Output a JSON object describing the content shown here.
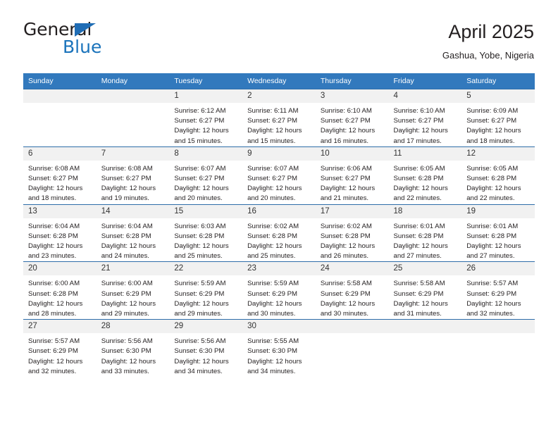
{
  "brand": {
    "name_top": "General",
    "name_bottom": "Blue",
    "accent_color": "#1a73bb",
    "triangle_color": "#1f6db5"
  },
  "header": {
    "title": "April 2025",
    "subtitle": "Gashua, Yobe, Nigeria"
  },
  "theme": {
    "header_bg": "#3279bd",
    "row_separator": "#2e6da9",
    "daynum_bg": "#f1f1f1",
    "text": "#231f20"
  },
  "calendar": {
    "weekday_headers": [
      "Sunday",
      "Monday",
      "Tuesday",
      "Wednesday",
      "Thursday",
      "Friday",
      "Saturday"
    ],
    "weeks": [
      [
        {
          "day": "",
          "blank": true
        },
        {
          "day": "",
          "blank": true
        },
        {
          "day": "1",
          "sunrise": "Sunrise: 6:12 AM",
          "sunset": "Sunset: 6:27 PM",
          "daylight_1": "Daylight: 12 hours",
          "daylight_2": "and 15 minutes."
        },
        {
          "day": "2",
          "sunrise": "Sunrise: 6:11 AM",
          "sunset": "Sunset: 6:27 PM",
          "daylight_1": "Daylight: 12 hours",
          "daylight_2": "and 15 minutes."
        },
        {
          "day": "3",
          "sunrise": "Sunrise: 6:10 AM",
          "sunset": "Sunset: 6:27 PM",
          "daylight_1": "Daylight: 12 hours",
          "daylight_2": "and 16 minutes."
        },
        {
          "day": "4",
          "sunrise": "Sunrise: 6:10 AM",
          "sunset": "Sunset: 6:27 PM",
          "daylight_1": "Daylight: 12 hours",
          "daylight_2": "and 17 minutes."
        },
        {
          "day": "5",
          "sunrise": "Sunrise: 6:09 AM",
          "sunset": "Sunset: 6:27 PM",
          "daylight_1": "Daylight: 12 hours",
          "daylight_2": "and 18 minutes."
        }
      ],
      [
        {
          "day": "6",
          "sunrise": "Sunrise: 6:08 AM",
          "sunset": "Sunset: 6:27 PM",
          "daylight_1": "Daylight: 12 hours",
          "daylight_2": "and 18 minutes."
        },
        {
          "day": "7",
          "sunrise": "Sunrise: 6:08 AM",
          "sunset": "Sunset: 6:27 PM",
          "daylight_1": "Daylight: 12 hours",
          "daylight_2": "and 19 minutes."
        },
        {
          "day": "8",
          "sunrise": "Sunrise: 6:07 AM",
          "sunset": "Sunset: 6:27 PM",
          "daylight_1": "Daylight: 12 hours",
          "daylight_2": "and 20 minutes."
        },
        {
          "day": "9",
          "sunrise": "Sunrise: 6:07 AM",
          "sunset": "Sunset: 6:27 PM",
          "daylight_1": "Daylight: 12 hours",
          "daylight_2": "and 20 minutes."
        },
        {
          "day": "10",
          "sunrise": "Sunrise: 6:06 AM",
          "sunset": "Sunset: 6:27 PM",
          "daylight_1": "Daylight: 12 hours",
          "daylight_2": "and 21 minutes."
        },
        {
          "day": "11",
          "sunrise": "Sunrise: 6:05 AM",
          "sunset": "Sunset: 6:28 PM",
          "daylight_1": "Daylight: 12 hours",
          "daylight_2": "and 22 minutes."
        },
        {
          "day": "12",
          "sunrise": "Sunrise: 6:05 AM",
          "sunset": "Sunset: 6:28 PM",
          "daylight_1": "Daylight: 12 hours",
          "daylight_2": "and 22 minutes."
        }
      ],
      [
        {
          "day": "13",
          "sunrise": "Sunrise: 6:04 AM",
          "sunset": "Sunset: 6:28 PM",
          "daylight_1": "Daylight: 12 hours",
          "daylight_2": "and 23 minutes."
        },
        {
          "day": "14",
          "sunrise": "Sunrise: 6:04 AM",
          "sunset": "Sunset: 6:28 PM",
          "daylight_1": "Daylight: 12 hours",
          "daylight_2": "and 24 minutes."
        },
        {
          "day": "15",
          "sunrise": "Sunrise: 6:03 AM",
          "sunset": "Sunset: 6:28 PM",
          "daylight_1": "Daylight: 12 hours",
          "daylight_2": "and 25 minutes."
        },
        {
          "day": "16",
          "sunrise": "Sunrise: 6:02 AM",
          "sunset": "Sunset: 6:28 PM",
          "daylight_1": "Daylight: 12 hours",
          "daylight_2": "and 25 minutes."
        },
        {
          "day": "17",
          "sunrise": "Sunrise: 6:02 AM",
          "sunset": "Sunset: 6:28 PM",
          "daylight_1": "Daylight: 12 hours",
          "daylight_2": "and 26 minutes."
        },
        {
          "day": "18",
          "sunrise": "Sunrise: 6:01 AM",
          "sunset": "Sunset: 6:28 PM",
          "daylight_1": "Daylight: 12 hours",
          "daylight_2": "and 27 minutes."
        },
        {
          "day": "19",
          "sunrise": "Sunrise: 6:01 AM",
          "sunset": "Sunset: 6:28 PM",
          "daylight_1": "Daylight: 12 hours",
          "daylight_2": "and 27 minutes."
        }
      ],
      [
        {
          "day": "20",
          "sunrise": "Sunrise: 6:00 AM",
          "sunset": "Sunset: 6:28 PM",
          "daylight_1": "Daylight: 12 hours",
          "daylight_2": "and 28 minutes."
        },
        {
          "day": "21",
          "sunrise": "Sunrise: 6:00 AM",
          "sunset": "Sunset: 6:29 PM",
          "daylight_1": "Daylight: 12 hours",
          "daylight_2": "and 29 minutes."
        },
        {
          "day": "22",
          "sunrise": "Sunrise: 5:59 AM",
          "sunset": "Sunset: 6:29 PM",
          "daylight_1": "Daylight: 12 hours",
          "daylight_2": "and 29 minutes."
        },
        {
          "day": "23",
          "sunrise": "Sunrise: 5:59 AM",
          "sunset": "Sunset: 6:29 PM",
          "daylight_1": "Daylight: 12 hours",
          "daylight_2": "and 30 minutes."
        },
        {
          "day": "24",
          "sunrise": "Sunrise: 5:58 AM",
          "sunset": "Sunset: 6:29 PM",
          "daylight_1": "Daylight: 12 hours",
          "daylight_2": "and 30 minutes."
        },
        {
          "day": "25",
          "sunrise": "Sunrise: 5:58 AM",
          "sunset": "Sunset: 6:29 PM",
          "daylight_1": "Daylight: 12 hours",
          "daylight_2": "and 31 minutes."
        },
        {
          "day": "26",
          "sunrise": "Sunrise: 5:57 AM",
          "sunset": "Sunset: 6:29 PM",
          "daylight_1": "Daylight: 12 hours",
          "daylight_2": "and 32 minutes."
        }
      ],
      [
        {
          "day": "27",
          "sunrise": "Sunrise: 5:57 AM",
          "sunset": "Sunset: 6:29 PM",
          "daylight_1": "Daylight: 12 hours",
          "daylight_2": "and 32 minutes."
        },
        {
          "day": "28",
          "sunrise": "Sunrise: 5:56 AM",
          "sunset": "Sunset: 6:30 PM",
          "daylight_1": "Daylight: 12 hours",
          "daylight_2": "and 33 minutes."
        },
        {
          "day": "29",
          "sunrise": "Sunrise: 5:56 AM",
          "sunset": "Sunset: 6:30 PM",
          "daylight_1": "Daylight: 12 hours",
          "daylight_2": "and 34 minutes."
        },
        {
          "day": "30",
          "sunrise": "Sunrise: 5:55 AM",
          "sunset": "Sunset: 6:30 PM",
          "daylight_1": "Daylight: 12 hours",
          "daylight_2": "and 34 minutes."
        },
        {
          "day": "",
          "blank": true
        },
        {
          "day": "",
          "blank": true
        },
        {
          "day": "",
          "blank": true
        }
      ]
    ]
  }
}
